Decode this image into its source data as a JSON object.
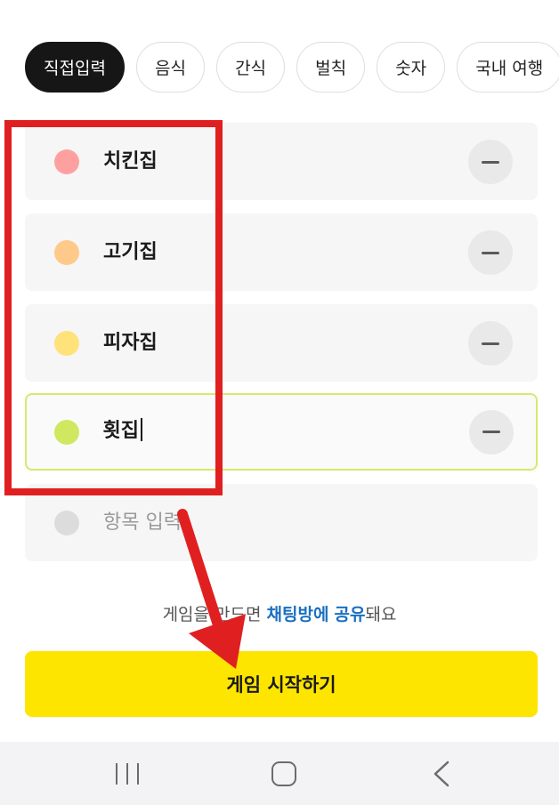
{
  "tabs": [
    {
      "label": "직접입력",
      "active": true
    },
    {
      "label": "음식",
      "active": false
    },
    {
      "label": "간식",
      "active": false
    },
    {
      "label": "벌칙",
      "active": false
    },
    {
      "label": "숫자",
      "active": false
    },
    {
      "label": "국내 여행",
      "active": false
    }
  ],
  "items": [
    {
      "label": "치킨집",
      "color": "#ffa0a0"
    },
    {
      "label": "고기집",
      "color": "#ffc98a"
    },
    {
      "label": "피자집",
      "color": "#ffe27a"
    },
    {
      "label": "횟집",
      "color": "#cfe860",
      "focused": true
    },
    {
      "placeholder": "항목 입력",
      "color": "#dcdcdc"
    }
  ],
  "share": {
    "prefix": "게임을 ",
    "obscured": "만드면 ",
    "link1": "채팅방에",
    "space": " ",
    "link2": "공유",
    "suffix": "돼요"
  },
  "start_button": {
    "label": "게임 시작하기"
  },
  "colors": {
    "accent": "#fee500",
    "annotation": "#e02020",
    "focus_border": "#d4ea6d",
    "link": "#1a6fc0"
  },
  "icons": {
    "recent": "recent-apps-icon",
    "home": "home-icon",
    "back": "back-icon"
  }
}
